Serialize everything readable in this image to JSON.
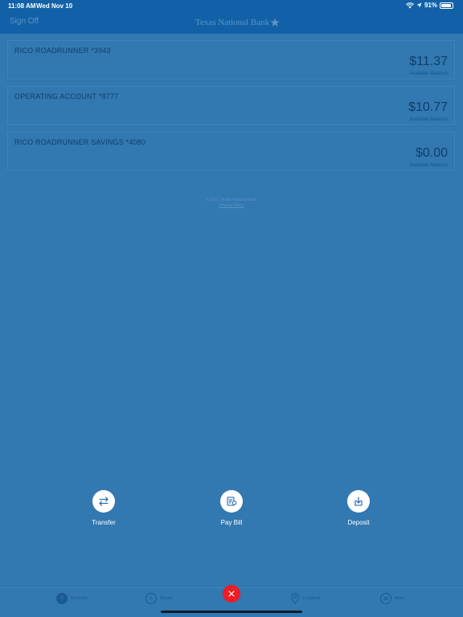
{
  "status_bar": {
    "time": "11:08 AM",
    "date": "Wed Nov 10",
    "battery": "91%",
    "battery_level": 0.91
  },
  "header": {
    "sign_off": "Sign Off",
    "logo": "Texas National Bank"
  },
  "accounts": [
    {
      "name": "RICO ROADRUNNER *3943",
      "balance": "$11.37",
      "balance_label": "Available Balance"
    },
    {
      "name": "OPERATING ACCOUNT *8777",
      "balance": "$10.77",
      "balance_label": "Available Balance"
    },
    {
      "name": "RICO ROADRUNNER SAVINGS *4080",
      "balance": "$0.00",
      "balance_label": "Available Balance"
    }
  ],
  "footer": {
    "copyright": "© 2021 Texas National Bank",
    "privacy": "Privacy Policy"
  },
  "actions": [
    {
      "label": "Transfer",
      "icon": "transfer-icon"
    },
    {
      "label": "Pay Bill",
      "icon": "pay-bill-icon"
    },
    {
      "label": "Deposit",
      "icon": "deposit-icon"
    }
  ],
  "tabs": [
    {
      "label": "Accounts",
      "icon": "accounts-icon"
    },
    {
      "label": "Recent",
      "icon": "clock-icon"
    },
    {
      "label": "Locations",
      "icon": "location-pin-icon"
    },
    {
      "label": "More",
      "icon": "menu-icon"
    }
  ],
  "colors": {
    "background": "#3278b1",
    "header": "#1261a8",
    "close_button": "#ee1c25"
  }
}
